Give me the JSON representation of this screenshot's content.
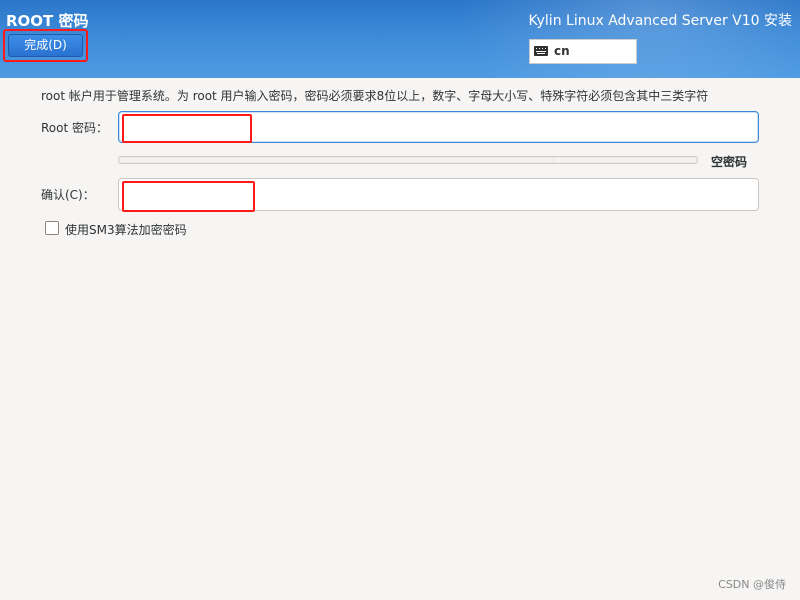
{
  "header": {
    "page_title": "ROOT 密码",
    "product_title": "Kylin Linux Advanced Server V10 安装",
    "done_label": "完成(D)",
    "keyboard_layout": "cn"
  },
  "form": {
    "description": "root 帐户用于管理系统。为 root 用户输入密码，密码必须要求8位以上，数字、字母大小写、特殊字符必须包含其中三类字符",
    "root_label": "Root 密码：",
    "root_value": "",
    "strength_text": "空密码",
    "strength_level": 0,
    "confirm_label": "确认(C)：",
    "confirm_value": "",
    "sm3_checkbox_label": "使用SM3算法加密密码",
    "sm3_checked": false
  },
  "watermark": "CSDN @俊侍",
  "colors": {
    "header_blue": "#3d8ad8",
    "highlight_red": "#ff1a1a",
    "focus_blue": "#3b87d8"
  }
}
